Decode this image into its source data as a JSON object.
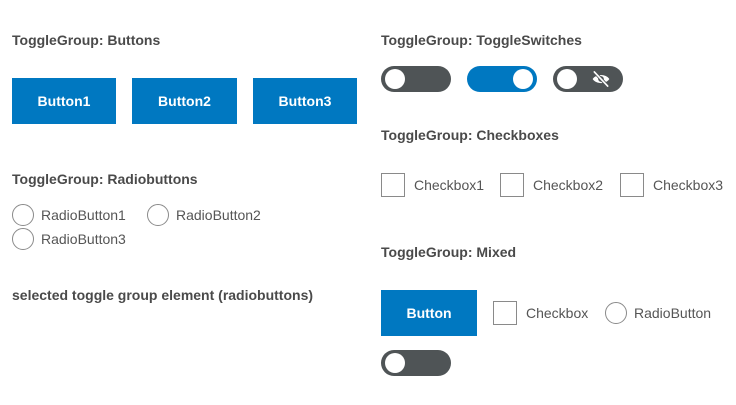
{
  "buttons_group": {
    "heading": "ToggleGroup: Buttons",
    "items": [
      {
        "label": "Button1"
      },
      {
        "label": "Button2"
      },
      {
        "label": "Button3"
      }
    ]
  },
  "radios_group": {
    "heading": "ToggleGroup: Radiobuttons",
    "items": [
      {
        "label": "RadioButton1"
      },
      {
        "label": "RadioButton2"
      },
      {
        "label": "RadioButton3"
      }
    ]
  },
  "selected_text": "selected toggle group element (radiobuttons)",
  "switches_group": {
    "heading": "ToggleGroup: ToggleSwitches",
    "items": [
      {
        "state": "off"
      },
      {
        "state": "on"
      },
      {
        "state": "off",
        "icon": "eye-slash-icon"
      }
    ]
  },
  "checkboxes_group": {
    "heading": "ToggleGroup: Checkboxes",
    "items": [
      {
        "label": "Checkbox1"
      },
      {
        "label": "Checkbox2"
      },
      {
        "label": "Checkbox3"
      }
    ]
  },
  "mixed_group": {
    "heading": "ToggleGroup: Mixed",
    "button_label": "Button",
    "checkbox_label": "Checkbox",
    "radio_label": "RadioButton",
    "switch_state": "off"
  },
  "colors": {
    "accent": "#0078c1",
    "switch_off": "#4f5456",
    "text": "#4a4a4a"
  }
}
